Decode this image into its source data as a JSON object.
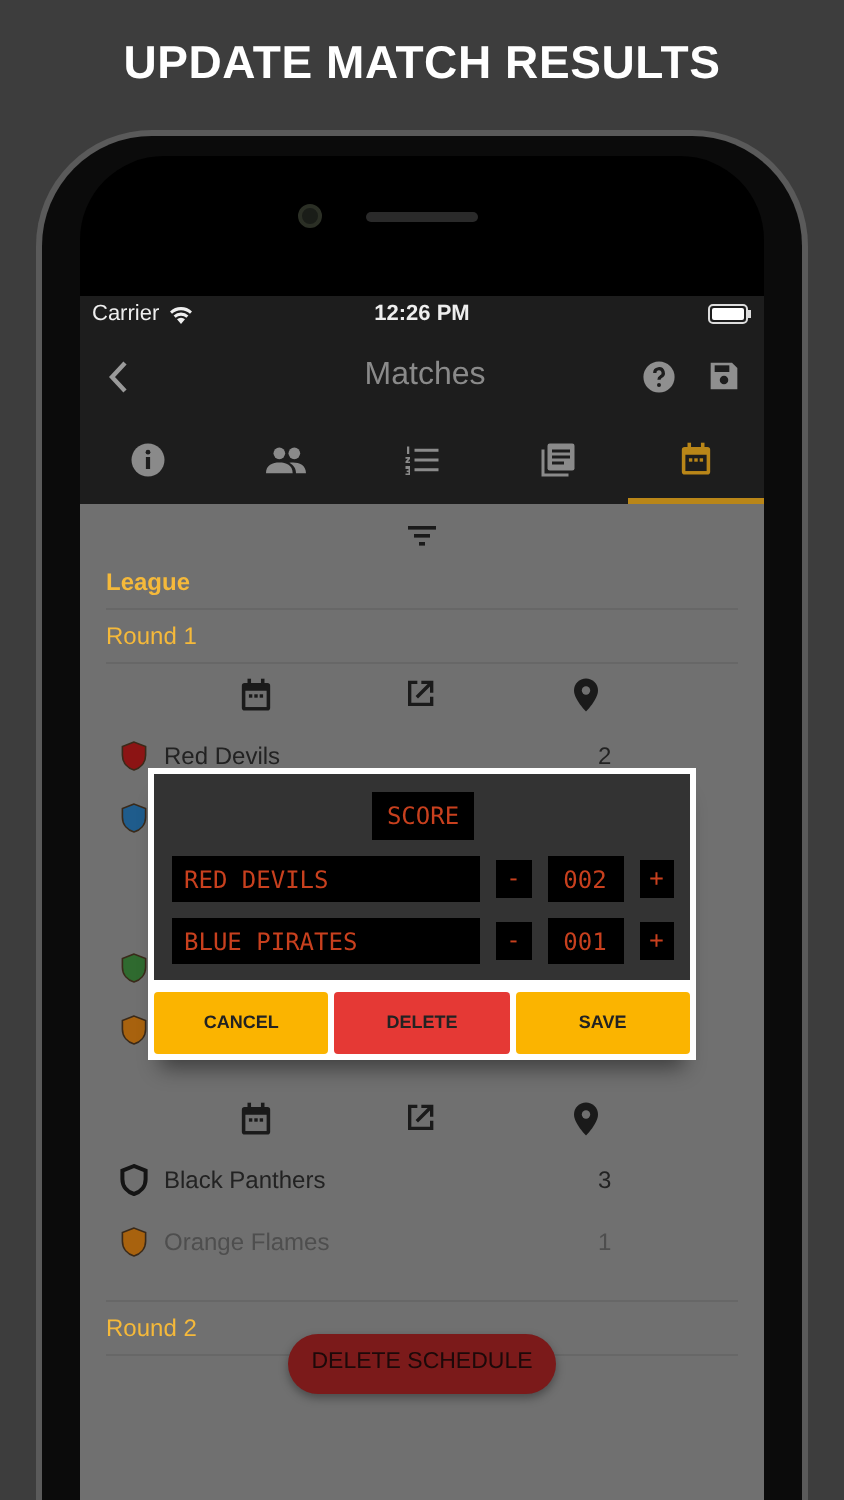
{
  "headline": "UPDATE MATCH RESULTS",
  "status_bar": {
    "carrier": "Carrier",
    "time": "12:26 PM"
  },
  "nav": {
    "title": "Matches"
  },
  "tabs": [
    {
      "kind": "info",
      "selected": false
    },
    {
      "kind": "people",
      "selected": false
    },
    {
      "kind": "list",
      "selected": false
    },
    {
      "kind": "library",
      "selected": false
    },
    {
      "kind": "calendar",
      "selected": true
    }
  ],
  "section": "League",
  "rounds": [
    {
      "title": "Round 1",
      "matches": [
        {
          "teams": [
            {
              "name": "Red Devils",
              "score": "2",
              "winner": true,
              "kind": "filled",
              "color": "#8c1414"
            },
            {
              "kind": "filled",
              "color": "#1f5c8c"
            }
          ]
        },
        {
          "teams": [
            {
              "kind": "filled",
              "color": "#2f6a2f"
            },
            {
              "kind": "filled",
              "color": "#a8620e"
            }
          ]
        },
        {
          "teams": [
            {
              "name": "Black Panthers",
              "score": "3",
              "winner": true,
              "kind": "outline",
              "color": "#141414"
            },
            {
              "name": "Orange Flames",
              "score": "1",
              "winner": false,
              "kind": "filled",
              "color": "#a8620e"
            }
          ]
        }
      ]
    },
    {
      "title": "Round 2"
    }
  ],
  "dialog": {
    "title": "SCORE",
    "rows": [
      {
        "team": "RED DEVILS",
        "score": "002",
        "minus": "-",
        "plus": "+"
      },
      {
        "team": "BLUE PIRATES",
        "score": "001",
        "minus": "-",
        "plus": "+"
      }
    ],
    "buttons": [
      {
        "label": "CANCEL",
        "kind": "neutral"
      },
      {
        "label": "DELETE",
        "kind": "danger"
      },
      {
        "label": "SAVE",
        "kind": "neutral"
      }
    ]
  },
  "footer_button": "DELETE SCHEDULE"
}
